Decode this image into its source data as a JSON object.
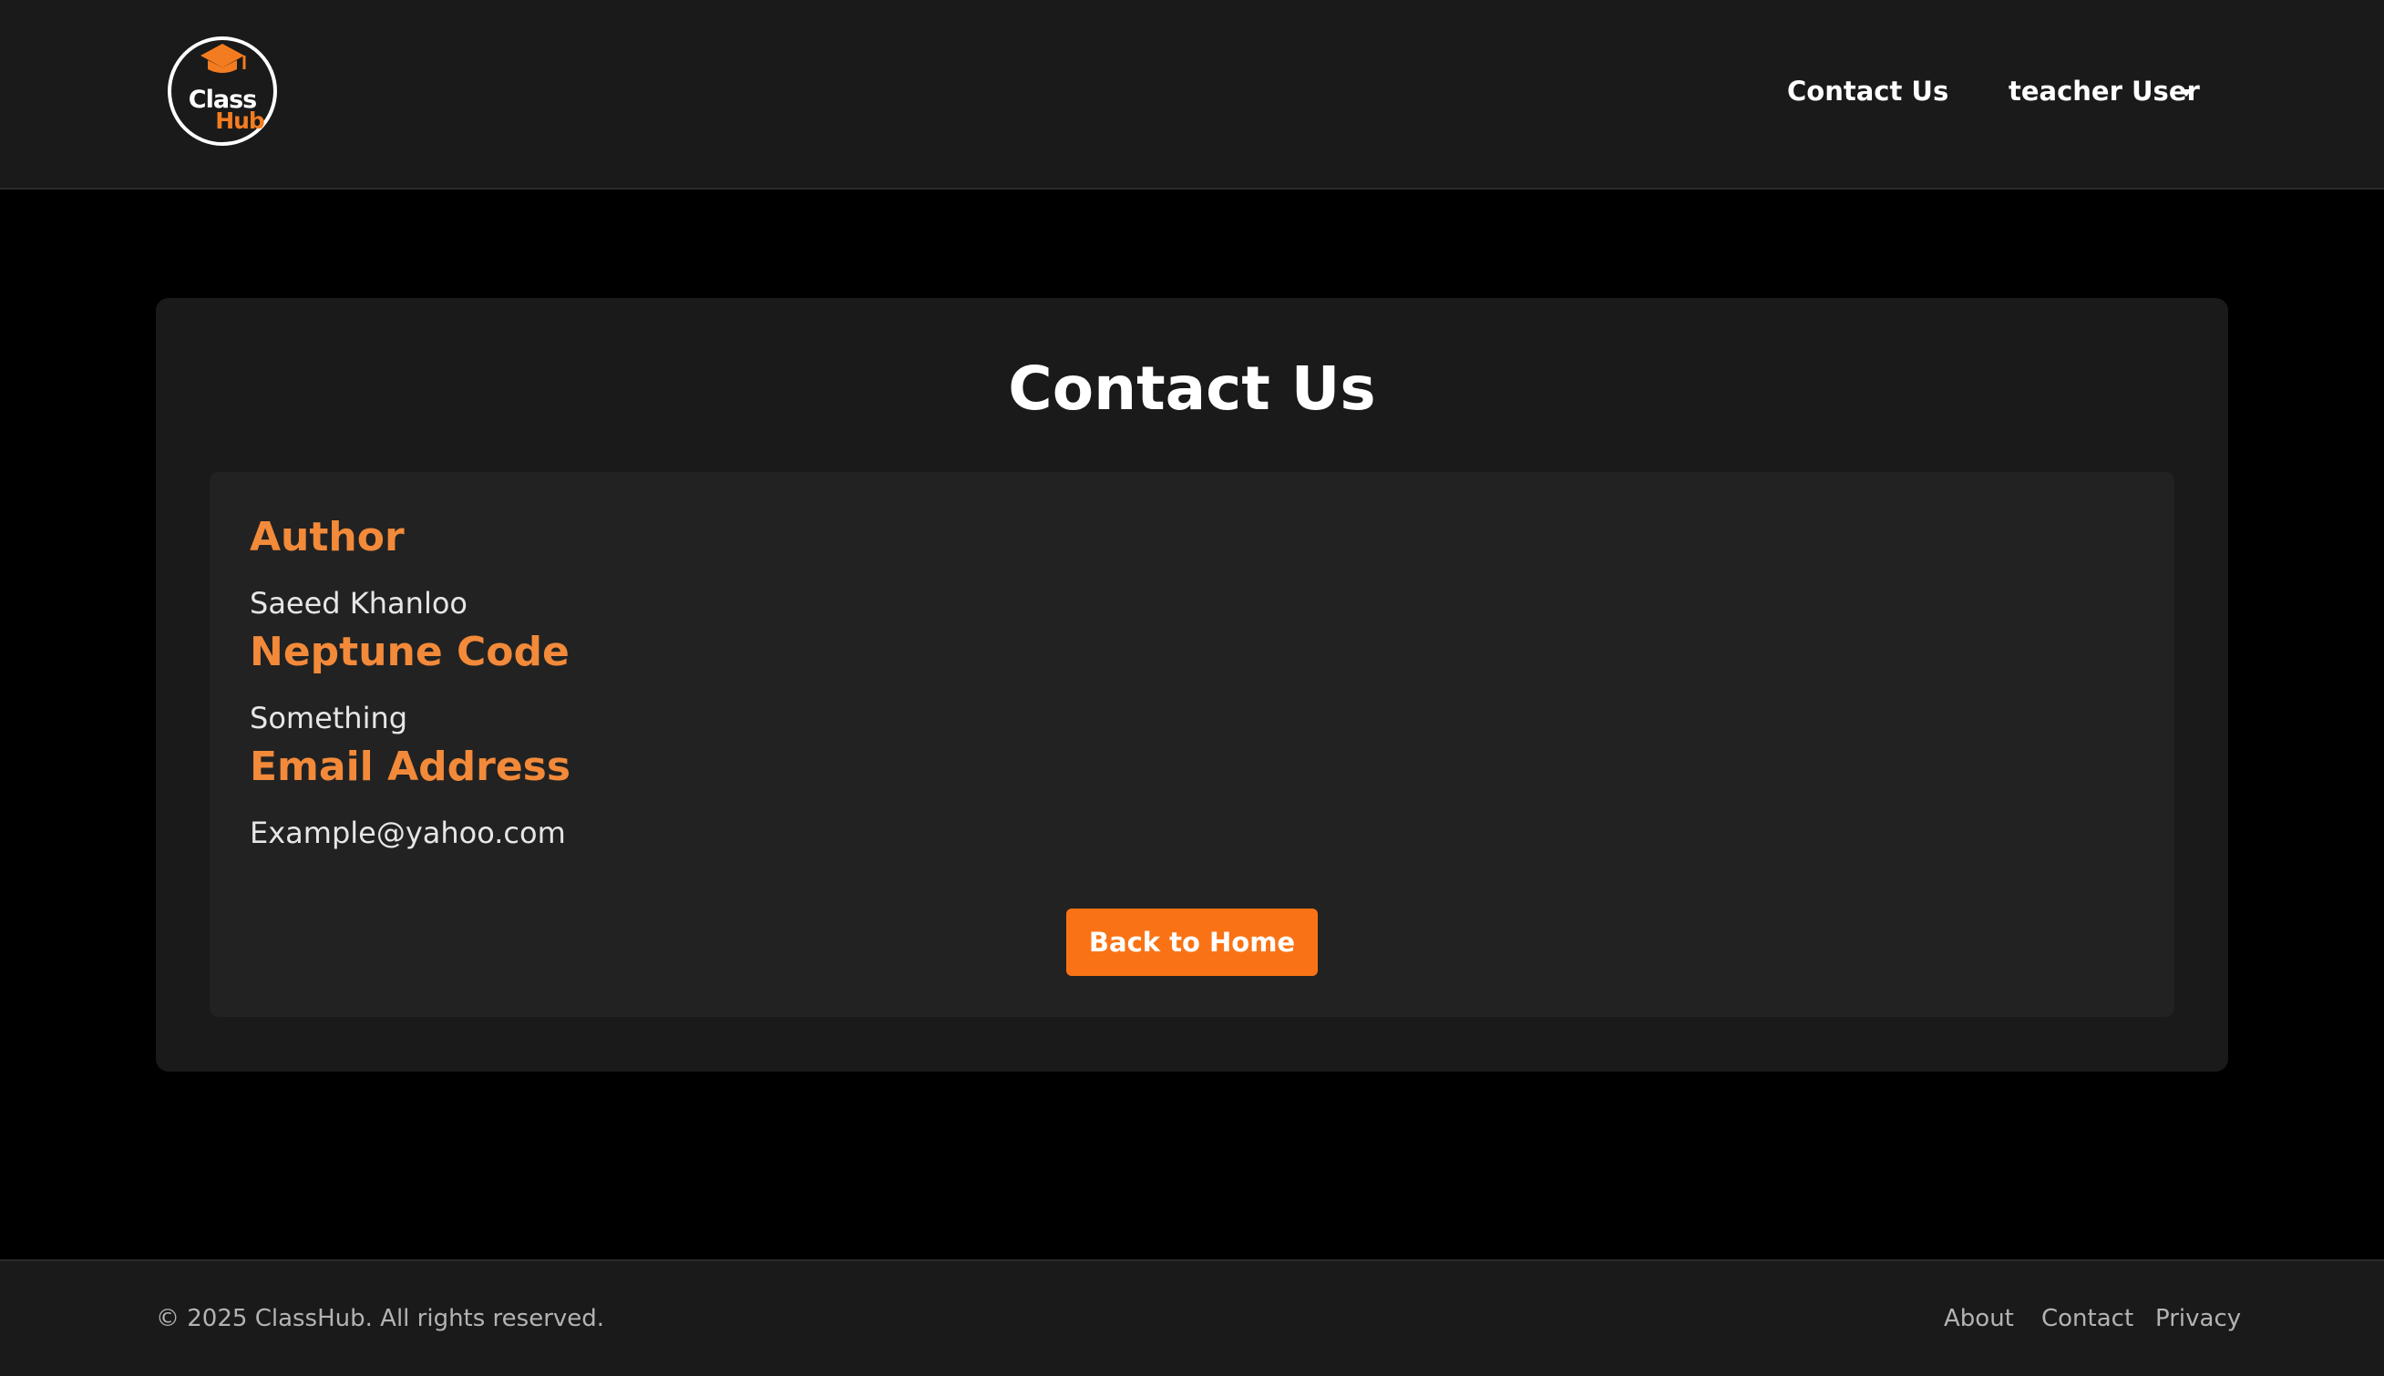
{
  "header": {
    "logo": {
      "word_top": "Class",
      "word_bottom": "Hub",
      "icon": "graduation-cap-icon"
    },
    "nav": {
      "contact_label": "Contact Us",
      "user_label": "teacher User",
      "user_menu_icon": "caret-down-icon"
    }
  },
  "main": {
    "title": "Contact Us",
    "fields": [
      {
        "label": "Author",
        "value": "Saeed Khanloo"
      },
      {
        "label": "Neptune Code",
        "value": "Something"
      },
      {
        "label": "Email Address",
        "value": "Example@yahoo.com"
      }
    ],
    "back_button_label": "Back to Home"
  },
  "footer": {
    "copyright": "© 2025 ClassHub. All rights reserved.",
    "links": [
      "About",
      "Contact",
      "Privacy"
    ]
  },
  "colors": {
    "accent": "#f97316",
    "label_orange": "#f28a3a",
    "nav_bg": "#1a1a1a",
    "page_bg": "#000000",
    "card_bg": "#1a1a1a",
    "inner_card_bg": "#222222"
  }
}
